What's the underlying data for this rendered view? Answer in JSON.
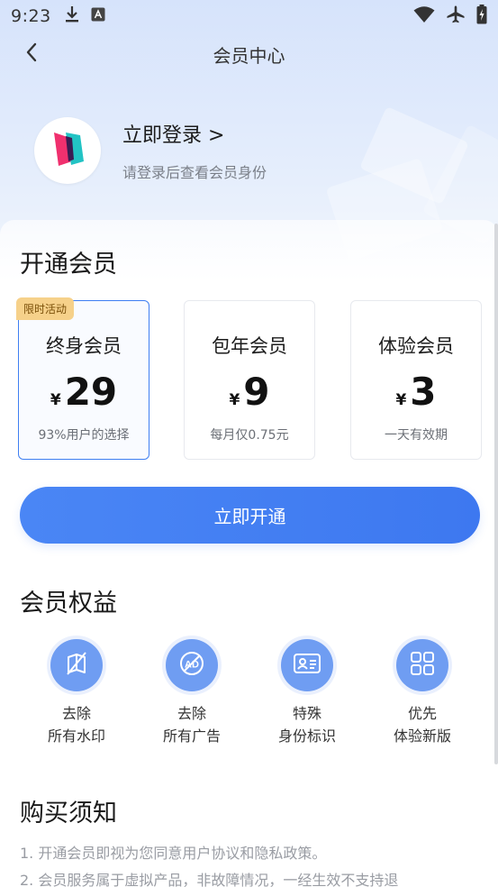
{
  "status_bar": {
    "time": "9:23",
    "left_icons": [
      "download-icon",
      "text-a-icon"
    ],
    "right_icons": [
      "wifi-icon",
      "airplane-icon",
      "battery-icon"
    ]
  },
  "nav": {
    "title": "会员中心",
    "back_icon": "chevron-left-icon"
  },
  "profile": {
    "login_label": "立即登录 >",
    "hint": "请登录后查看会员身份",
    "avatar_icon": "app-logo"
  },
  "membership": {
    "section_title": "开通会员",
    "plans": [
      {
        "badge": "限时活动",
        "name": "终身会员",
        "currency": "¥",
        "price": "29",
        "desc": "93%用户的选择",
        "selected": true
      },
      {
        "name": "包年会员",
        "currency": "¥",
        "price": "9",
        "desc": "每月仅0.75元",
        "selected": false
      },
      {
        "name": "体验会员",
        "currency": "¥",
        "price": "3",
        "desc": "一天有效期",
        "selected": false
      }
    ],
    "cta_label": "立即开通"
  },
  "benefits": {
    "section_title": "会员权益",
    "items": [
      {
        "line1": "去除",
        "line2": "所有水印",
        "icon": "no-watermark-icon"
      },
      {
        "line1": "去除",
        "line2": "所有广告",
        "icon": "no-ad-icon"
      },
      {
        "line1": "特殊",
        "line2": "身份标识",
        "icon": "id-card-icon"
      },
      {
        "line1": "优先",
        "line2": "体验新版",
        "icon": "grid-apps-icon"
      }
    ]
  },
  "notice": {
    "section_title": "购买须知",
    "items": [
      "1. 开通会员即视为您同意用户协议和隐私政策。",
      "2. 会员服务属于虚拟产品，非故障情况，一经生效不支持退"
    ]
  },
  "colors": {
    "accent": "#3f7ff2",
    "badge": "#f6d18a",
    "benefit_icon_bg": "#6f9df2"
  }
}
